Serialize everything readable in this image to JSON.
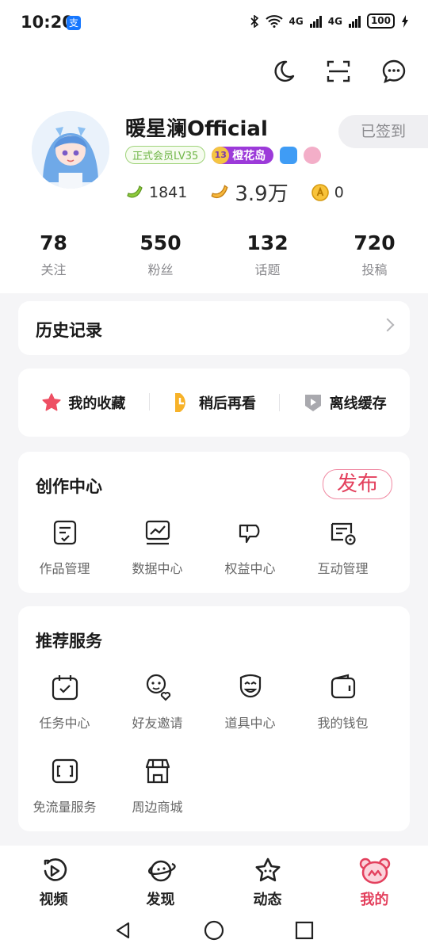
{
  "status_bar": {
    "time": "10:20",
    "alipay_icon": "支",
    "network_1": "4G",
    "network_2": "4G",
    "battery": "100"
  },
  "header": {
    "icons": [
      "moon-icon",
      "scan-icon",
      "message-icon"
    ]
  },
  "profile": {
    "username": "暖星澜Official",
    "checkin_label": "已签到",
    "member_badge": "正式会员LV35",
    "island_level": "13",
    "island_name": "橙花岛",
    "bananas": "1841",
    "gold_bananas": "3.9万",
    "coins": "0"
  },
  "stats": [
    {
      "value": "78",
      "label": "关注"
    },
    {
      "value": "550",
      "label": "粉丝"
    },
    {
      "value": "132",
      "label": "话题"
    },
    {
      "value": "720",
      "label": "投稿"
    }
  ],
  "history": {
    "title": "历史记录"
  },
  "quick_actions": [
    {
      "label": "我的收藏",
      "icon": "star-icon"
    },
    {
      "label": "稍后再看",
      "icon": "watch-later-icon"
    },
    {
      "label": "离线缓存",
      "icon": "download-icon"
    }
  ],
  "creation_center": {
    "title": "创作中心",
    "publish_label": "发布",
    "items": [
      {
        "label": "作品管理",
        "icon": "works-icon"
      },
      {
        "label": "数据中心",
        "icon": "chart-icon"
      },
      {
        "label": "权益中心",
        "icon": "benefit-icon"
      },
      {
        "label": "互动管理",
        "icon": "interaction-icon"
      }
    ]
  },
  "services": {
    "title": "推荐服务",
    "items": [
      {
        "label": "任务中心",
        "icon": "task-icon"
      },
      {
        "label": "好友邀请",
        "icon": "invite-icon"
      },
      {
        "label": "道具中心",
        "icon": "props-icon"
      },
      {
        "label": "我的钱包",
        "icon": "wallet-icon"
      },
      {
        "label": "免流量服务",
        "icon": "free-data-icon"
      },
      {
        "label": "周边商城",
        "icon": "shop-icon"
      }
    ]
  },
  "bottom_nav": [
    {
      "label": "视频",
      "icon": "video-icon"
    },
    {
      "label": "发现",
      "icon": "planet-icon"
    },
    {
      "label": "动态",
      "icon": "star-face-icon"
    },
    {
      "label": "我的",
      "icon": "bear-icon"
    }
  ],
  "colors": {
    "accent": "#e3405d",
    "member_green": "#6eb546",
    "island_purple": "#9c3ad9"
  }
}
